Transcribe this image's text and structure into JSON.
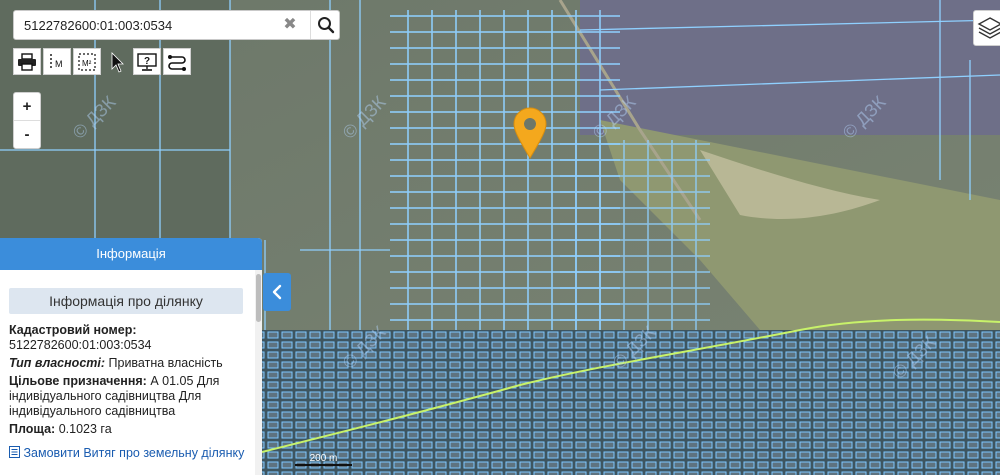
{
  "search": {
    "value": "5122782600:01:003:0534"
  },
  "zoom": {
    "in_label": "+",
    "out_label": "-"
  },
  "toolbar": {
    "measure_line_label": "M",
    "measure_area_label": "M²"
  },
  "info_panel": {
    "header": "Інформація",
    "title": "Інформація про ділянку",
    "cadastral_label": "Кадастровий номер:",
    "cadastral_value": "5122782600:01:003:0534",
    "ownership_label": "Тип власності:",
    "ownership_value": "Приватна власність",
    "purpose_label": "Цільове призначення:",
    "purpose_value": "А 01.05 Для індивідуального садівництва Для індивідуального садівництва",
    "area_label": "Площа:",
    "area_value": "0.1023 га",
    "order_link": "Замовити Витяг про земельну ділянку"
  },
  "scale": {
    "label": "200 m"
  },
  "watermark": "© ДЗК",
  "colors": {
    "accent": "#3b8ddb",
    "marker": "#f4a81d",
    "parcel_outline": "#8fd0ff",
    "boundary": "#c8f26a"
  }
}
